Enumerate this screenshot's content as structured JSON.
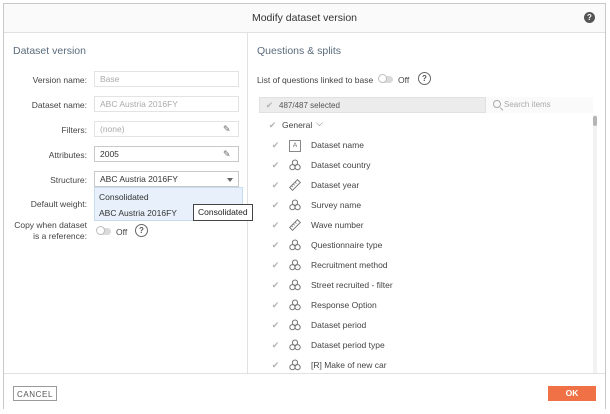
{
  "dialog": {
    "title": "Modify dataset version",
    "help_icon": "question-circle-icon"
  },
  "left": {
    "section_title": "Dataset version",
    "fields": {
      "version_name": {
        "label": "Version name:",
        "value": "Base"
      },
      "dataset_name": {
        "label": "Dataset name:",
        "value": "ABC Austria 2016FY"
      },
      "filters": {
        "label": "Filters:",
        "value": "(none)"
      },
      "attributes": {
        "label": "Attributes:",
        "value": "2005"
      },
      "structure": {
        "label": "Structure:",
        "value": "ABC Austria 2016FY"
      },
      "default_weight": {
        "label": "Default weight:"
      },
      "copy_reference": {
        "label_line1": "Copy when dataset",
        "label_line2": "is a reference:",
        "toggle": "Off"
      }
    },
    "structure_dropdown": {
      "options": [
        "Consolidated",
        "ABC Austria 2016FY"
      ]
    },
    "tooltip": "Consolidated"
  },
  "right": {
    "section_title": "Questions & splits",
    "linked_label": "List of questions linked to base",
    "linked_toggle": "Off",
    "selected_text": "487/487 selected",
    "search_placeholder": "Search items",
    "group_label": "General",
    "items": [
      {
        "name": "Dataset name",
        "icon": "text-type-icon",
        "icon_text": "A"
      },
      {
        "name": "Dataset country",
        "icon": "categorical-icon"
      },
      {
        "name": "Dataset year",
        "icon": "numeric-ruler-icon"
      },
      {
        "name": "Survey name",
        "icon": "categorical-icon"
      },
      {
        "name": "Wave number",
        "icon": "numeric-ruler-icon"
      },
      {
        "name": "Questionnaire type",
        "icon": "categorical-icon"
      },
      {
        "name": "Recruitment method",
        "icon": "categorical-icon"
      },
      {
        "name": "Street recruited - filter",
        "icon": "categorical-icon"
      },
      {
        "name": "Response Option",
        "icon": "categorical-icon"
      },
      {
        "name": "Dataset period",
        "icon": "categorical-icon"
      },
      {
        "name": "Dataset period type",
        "icon": "categorical-icon"
      },
      {
        "name": "[R] Make of new car",
        "icon": "categorical-icon"
      }
    ]
  },
  "footer": {
    "cancel_label": "CANCEL",
    "ok_label": "OK"
  },
  "colors": {
    "ok_button": "#ef7145",
    "section_title": "#5a6b7b",
    "dropdown_bg": "#e8f1fb"
  }
}
